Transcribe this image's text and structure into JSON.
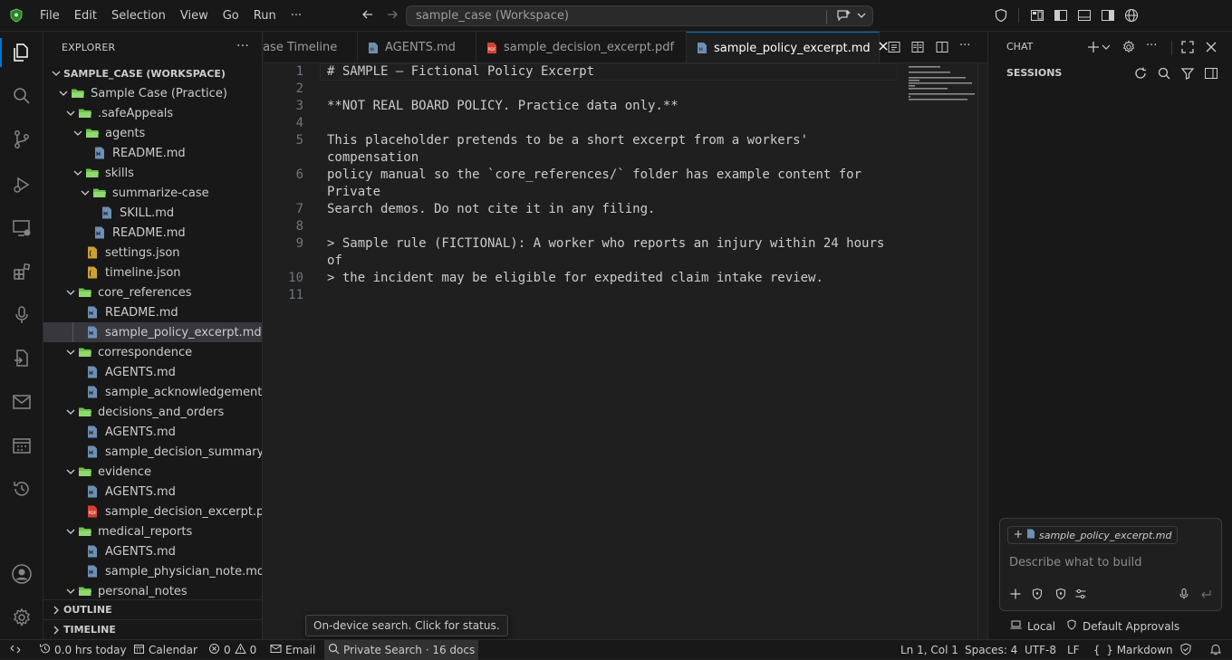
{
  "titlebar": {
    "menus": [
      "File",
      "Edit",
      "Selection",
      "View",
      "Go",
      "Run"
    ],
    "more_label": "···",
    "command_center": "sample_case (Workspace)"
  },
  "explorer": {
    "title": "EXPLORER",
    "more_label": "···",
    "workspace": "SAMPLE_CASE (WORKSPACE)",
    "items": [
      {
        "label": "Sample Case (Practice)",
        "type": "folder",
        "depth": 0
      },
      {
        "label": ".safeAppeals",
        "type": "folder",
        "depth": 1
      },
      {
        "label": "agents",
        "type": "folder",
        "depth": 2
      },
      {
        "label": "README.md",
        "type": "md",
        "depth": 3
      },
      {
        "label": "skills",
        "type": "folder",
        "depth": 2
      },
      {
        "label": "summarize-case",
        "type": "folder",
        "depth": 3
      },
      {
        "label": "SKILL.md",
        "type": "md",
        "depth": 4
      },
      {
        "label": "README.md",
        "type": "md",
        "depth": 3
      },
      {
        "label": "settings.json",
        "type": "json",
        "depth": 2
      },
      {
        "label": "timeline.json",
        "type": "json",
        "depth": 2
      },
      {
        "label": "core_references",
        "type": "folder",
        "depth": 1
      },
      {
        "label": "README.md",
        "type": "md",
        "depth": 2
      },
      {
        "label": "sample_policy_excerpt.md",
        "type": "md",
        "depth": 2,
        "selected": true
      },
      {
        "label": "correspondence",
        "type": "folder",
        "depth": 1
      },
      {
        "label": "AGENTS.md",
        "type": "md",
        "depth": 2
      },
      {
        "label": "sample_acknowledgement....",
        "type": "md",
        "depth": 2
      },
      {
        "label": "decisions_and_orders",
        "type": "folder",
        "depth": 1
      },
      {
        "label": "AGENTS.md",
        "type": "md",
        "depth": 2
      },
      {
        "label": "sample_decision_summary....",
        "type": "md",
        "depth": 2
      },
      {
        "label": "evidence",
        "type": "folder",
        "depth": 1
      },
      {
        "label": "AGENTS.md",
        "type": "md",
        "depth": 2
      },
      {
        "label": "sample_decision_excerpt.pdf",
        "type": "pdf",
        "depth": 2
      },
      {
        "label": "medical_reports",
        "type": "folder",
        "depth": 1
      },
      {
        "label": "AGENTS.md",
        "type": "md",
        "depth": 2
      },
      {
        "label": "sample_physician_note.md",
        "type": "md",
        "depth": 2
      },
      {
        "label": "personal_notes",
        "type": "folder",
        "depth": 1
      }
    ],
    "outline": "OUTLINE",
    "timeline": "TIMELINE"
  },
  "tabs": [
    {
      "label": "Case Timeline",
      "icon": "none"
    },
    {
      "label": "AGENTS.md",
      "icon": "md-file-icon"
    },
    {
      "label": "sample_decision_excerpt.pdf",
      "icon": "pdf-file-icon"
    },
    {
      "label": "sample_policy_excerpt.md",
      "icon": "md-file-icon",
      "active": true
    }
  ],
  "editor": {
    "lines": [
      {
        "num": "1",
        "text": "# SAMPLE — Fictional Policy Excerpt"
      },
      {
        "num": "2",
        "text": ""
      },
      {
        "num": "3",
        "text": "**NOT REAL BOARD POLICY. Practice data only.**"
      },
      {
        "num": "4",
        "text": ""
      },
      {
        "num": "5",
        "text": "This placeholder pretends to be a short excerpt from a workers'"
      },
      {
        "num": "",
        "text": "compensation"
      },
      {
        "num": "6",
        "text": "policy manual so the `core_references/` folder has example content for"
      },
      {
        "num": "",
        "text": "Private"
      },
      {
        "num": "7",
        "text": "Search demos. Do not cite it in any filing."
      },
      {
        "num": "8",
        "text": ""
      },
      {
        "num": "9",
        "text": "> Sample rule (FICTIONAL): A worker who reports an injury within 24 hours"
      },
      {
        "num": "",
        "text": "of"
      },
      {
        "num": "10",
        "text": "> the incident may be eligible for expedited claim intake review."
      },
      {
        "num": "11",
        "text": ""
      }
    ]
  },
  "chat": {
    "title": "CHAT",
    "sessions": "SESSIONS",
    "context_file": "sample_policy_excerpt.md",
    "placeholder": "Describe what to build",
    "local_label": "Local",
    "approvals_label": "Default Approvals"
  },
  "tooltip": "On-device search. Click for status.",
  "statusbar": {
    "time": "0.0 hrs today",
    "calendar": "Calendar",
    "errors": "0",
    "warnings": "0",
    "email": "Email",
    "search": "Private Search · 16 docs",
    "position": "Ln 1, Col 1",
    "spaces": "Spaces: 4",
    "encoding": "UTF-8",
    "eol": "LF",
    "language": "Markdown"
  },
  "colors": {
    "folder": "#6cc24a",
    "md_file": "#6e8fb5",
    "json_file": "#cba135",
    "pdf_file": "#d6422f",
    "accent": "#0078d4"
  }
}
